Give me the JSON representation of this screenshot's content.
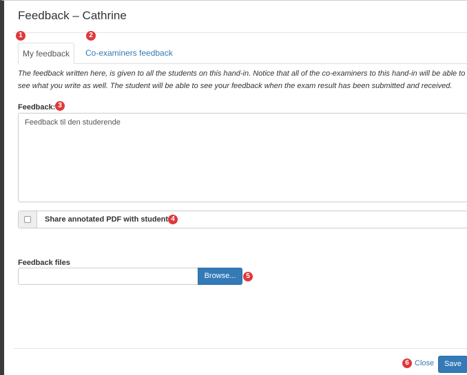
{
  "modal": {
    "title": "Feedback – Cathrine"
  },
  "badges": [
    "1",
    "2",
    "3",
    "4",
    "5",
    "6"
  ],
  "tabs": [
    {
      "label": "My feedback",
      "active": true
    },
    {
      "label": "Co-examiners feedback",
      "active": false
    }
  ],
  "info_text": "The feedback written here, is given to all the students on this hand-in. Notice that all of the co-examiners to this hand-in will be able to see what you write as well. The student will be able to see your feedback when the exam result has been submitted and received.",
  "feedback": {
    "label": "Feedback:",
    "value": "Feedback til den studerende"
  },
  "share": {
    "label": "Share annotated PDF with student",
    "checked": false
  },
  "files": {
    "label": "Feedback files",
    "value": "",
    "browse_label": "Browse..."
  },
  "footer": {
    "close_label": "Close",
    "save_label": "Save"
  },
  "colors": {
    "primary": "#337ab7",
    "badge": "#e0383b",
    "frame": "#3a3a3a"
  }
}
